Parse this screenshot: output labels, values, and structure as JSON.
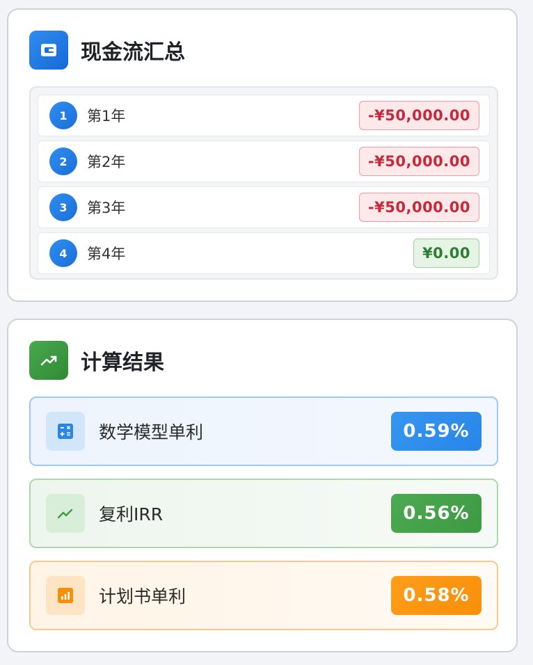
{
  "cashflow": {
    "title": "现金流汇总",
    "rows": [
      {
        "index": "1",
        "year": "第1年",
        "amount": "-¥50,000.00"
      },
      {
        "index": "2",
        "year": "第2年",
        "amount": "-¥50,000.00"
      },
      {
        "index": "3",
        "year": "第3年",
        "amount": "-¥50,000.00"
      },
      {
        "index": "4",
        "year": "第4年",
        "amount": "¥0.00"
      }
    ]
  },
  "results": {
    "title": "计算结果",
    "items": [
      {
        "label": "数学模型单利",
        "value": "0.59%",
        "icon": "calculator-icon"
      },
      {
        "label": "复利IRR",
        "value": "0.56%",
        "icon": "trend-icon"
      },
      {
        "label": "计划书单利",
        "value": "0.58%",
        "icon": "bar-chart-icon"
      }
    ]
  },
  "colors": {
    "blue": "#2f8df0",
    "green": "#3d9a43",
    "orange": "#f88f0a",
    "negative": "#c8283a",
    "positive": "#2e7d32"
  }
}
